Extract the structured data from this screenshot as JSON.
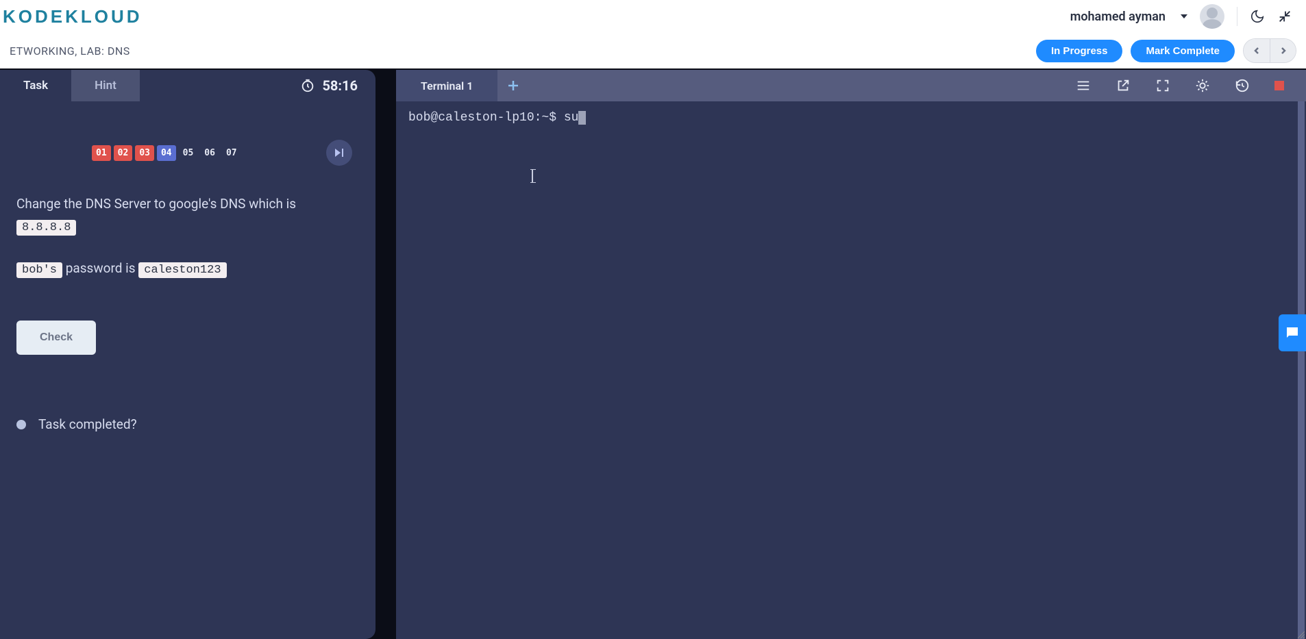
{
  "header": {
    "logo": "KODEKLOUD",
    "username": "mohamed ayman"
  },
  "subheader": {
    "breadcrumb": "ETWORKING, LAB: DNS",
    "in_progress_label": "In Progress",
    "mark_complete_label": "Mark Complete"
  },
  "task": {
    "tabs": {
      "task": "Task",
      "hint": "Hint"
    },
    "timer": "58:16",
    "steps": [
      "01",
      "02",
      "03",
      "04",
      "05",
      "06",
      "07"
    ],
    "desc_line1": "Change the DNS Server to google's DNS which is ",
    "desc_code1": "8.8.8.8",
    "pw_user": "bob's",
    "pw_mid": " password is ",
    "pw_pass": "caleston123",
    "check_label": "Check",
    "completed_label": "Task completed?"
  },
  "terminal": {
    "tab_label": "Terminal 1",
    "prompt": "bob@caleston-lp10:~$ ",
    "cmd": "su"
  }
}
